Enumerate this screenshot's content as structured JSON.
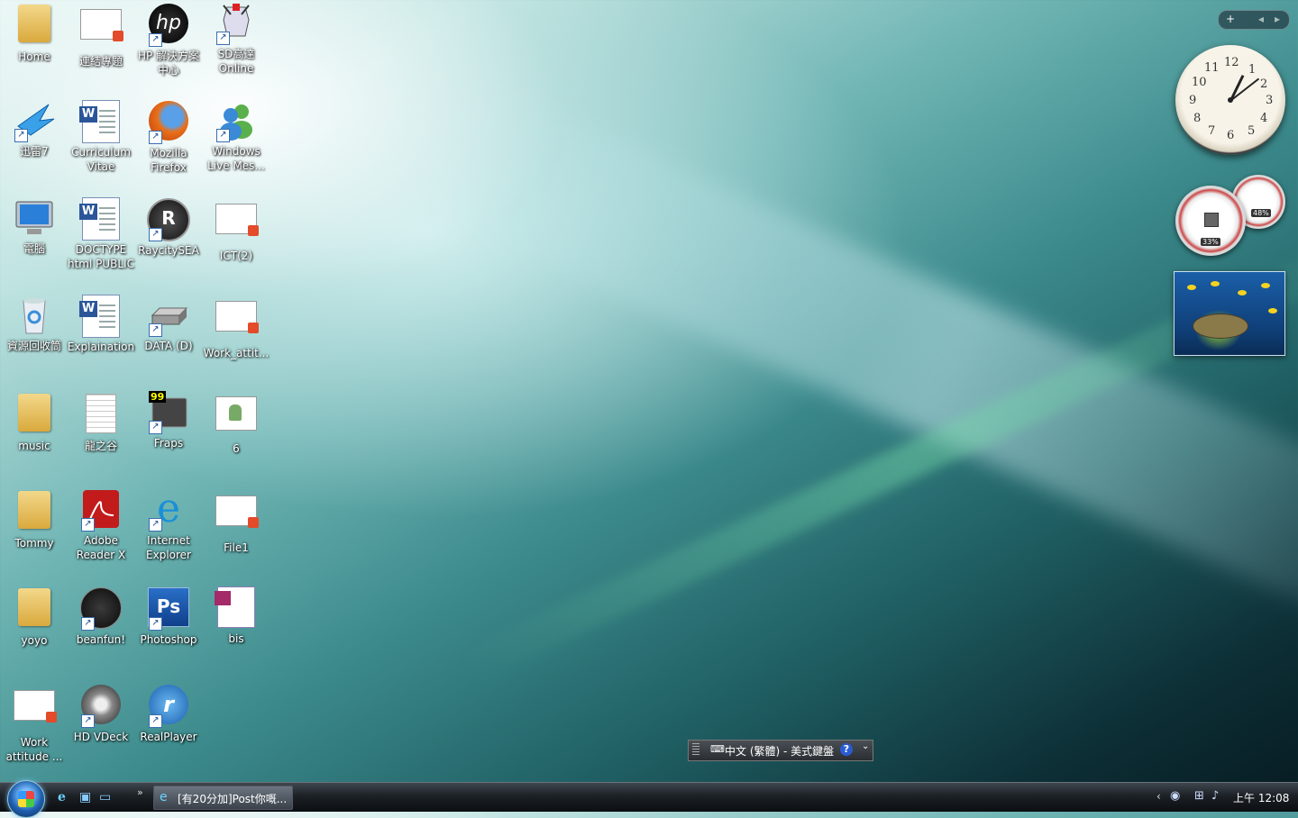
{
  "desktop": {
    "icons": [
      {
        "label": "Home"
      },
      {
        "label": "連結專題"
      },
      {
        "label": "HP 解決方案中心"
      },
      {
        "label": "SD高達 Online"
      },
      {
        "label": "迅雷7"
      },
      {
        "label": "Curriculum Vitae"
      },
      {
        "label": "Mozilla Firefox"
      },
      {
        "label": "Windows Live Mes..."
      },
      {
        "label": "電腦"
      },
      {
        "label": "DOCTYPE html PUBLIC"
      },
      {
        "label": "RaycitySEA"
      },
      {
        "label": "ICT(2)"
      },
      {
        "label": "資源回收筒"
      },
      {
        "label": "Explaination"
      },
      {
        "label": "DATA (D)"
      },
      {
        "label": "Work_attit..."
      },
      {
        "label": "music"
      },
      {
        "label": "龍之谷"
      },
      {
        "label": "Fraps"
      },
      {
        "label": "6"
      },
      {
        "label": "Tommy"
      },
      {
        "label": "Adobe Reader X"
      },
      {
        "label": "Internet Explorer"
      },
      {
        "label": "File1"
      },
      {
        "label": "yoyo"
      },
      {
        "label": "beanfun!"
      },
      {
        "label": "Photoshop"
      },
      {
        "label": "bis"
      },
      {
        "label": "Work attitude ..."
      },
      {
        "label": "HD VDeck"
      },
      {
        "label": "RealPlayer"
      }
    ],
    "fraps_counter": "99"
  },
  "gadgets": {
    "sidebar_controls": {
      "add": "+",
      "prev": "◂",
      "next": "▸"
    },
    "clock": {
      "numbers": [
        "12",
        "1",
        "2",
        "3",
        "4",
        "5",
        "6",
        "7",
        "8",
        "9",
        "10",
        "11"
      ]
    },
    "cpu_meter": {
      "cpu": "33%",
      "memory": "48%"
    }
  },
  "language_bar": {
    "label": "中文 (繁體) - 美式鍵盤",
    "help": "?",
    "more": "⌄"
  },
  "taskbar": {
    "chevron": "»",
    "task_button": "[有20分加]Post你嘅...",
    "tray_arrow": "‹",
    "time": "上午 12:08"
  }
}
